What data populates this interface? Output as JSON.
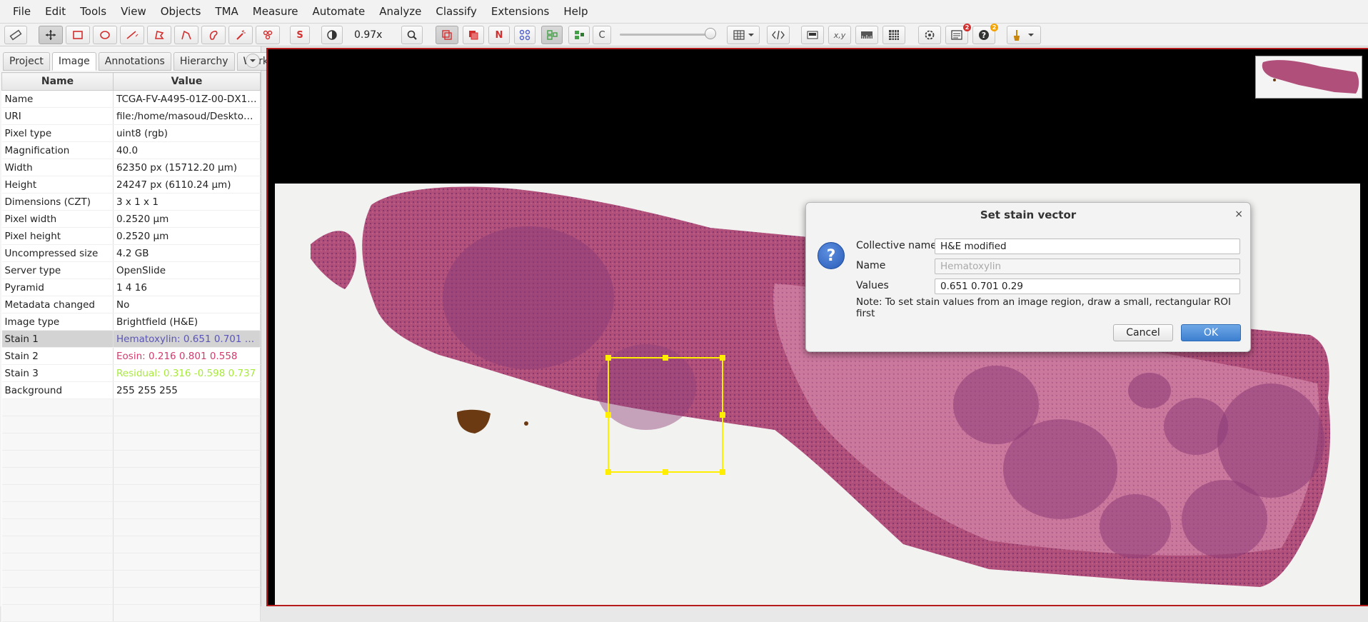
{
  "menu": [
    "File",
    "Edit",
    "Tools",
    "View",
    "Objects",
    "TMA",
    "Measure",
    "Automate",
    "Analyze",
    "Classify",
    "Extensions",
    "Help"
  ],
  "toolbar": {
    "stain_button_label": "S",
    "zoom": "0.97x",
    "n_button_label": "N",
    "c_button_label": "C",
    "xy_label": "x,y",
    "badge_log": "2",
    "badge_help": "2"
  },
  "left_tabs": [
    "Project",
    "Image",
    "Annotations",
    "Hierarchy",
    "Workfl"
  ],
  "table": {
    "headers": [
      "Name",
      "Value"
    ],
    "rows": [
      {
        "name": "Name",
        "value": "TCGA-FV-A495-01Z-00-DX1...."
      },
      {
        "name": "URI",
        "value": "file:/home/masoud/Desktop/..."
      },
      {
        "name": "Pixel type",
        "value": "uint8 (rgb)"
      },
      {
        "name": "Magnification",
        "value": "40.0"
      },
      {
        "name": "Width",
        "value": "62350 px (15712.20 µm)"
      },
      {
        "name": "Height",
        "value": "24247 px (6110.24 µm)"
      },
      {
        "name": "Dimensions (CZT)",
        "value": "3 x 1 x 1"
      },
      {
        "name": "Pixel width",
        "value": "0.2520 µm"
      },
      {
        "name": "Pixel height",
        "value": "0.2520 µm"
      },
      {
        "name": "Uncompressed size",
        "value": "4.2 GB"
      },
      {
        "name": "Server type",
        "value": "OpenSlide"
      },
      {
        "name": "Pyramid",
        "value": "1 4 16"
      },
      {
        "name": "Metadata changed",
        "value": "No"
      },
      {
        "name": "Image type",
        "value": "Brightfield (H&E)"
      },
      {
        "name": "Stain 1",
        "value": "Hematoxylin: 0.651 0.701 0...."
      },
      {
        "name": "Stain 2",
        "value": "Eosin: 0.216 0.801 0.558"
      },
      {
        "name": "Stain 3",
        "value": "Residual: 0.316 -0.598 0.737"
      },
      {
        "name": "Background",
        "value": "255 255 255"
      }
    ],
    "stain_colors": {
      "stain1": "#5a55b8",
      "stain2": "#d23a6e",
      "stain3": "#a8ea3a"
    }
  },
  "dialog": {
    "title": "Set stain vector",
    "collective_name_label": "Collective name",
    "collective_name_value": "H&E modified",
    "name_label": "Name",
    "name_value": "Hematoxylin",
    "values_label": "Values",
    "values_value": "0.651 0.701 0.29",
    "note": "Note: To set stain values from an image region, draw a small, rectangular ROI first",
    "cancel": "Cancel",
    "ok": "OK",
    "close_icon": "×"
  },
  "colors": {
    "accent": "#3d7fd0",
    "viewer_border": "#b71c1c",
    "roi": "#ffee00",
    "tissue": "#b0507a"
  }
}
